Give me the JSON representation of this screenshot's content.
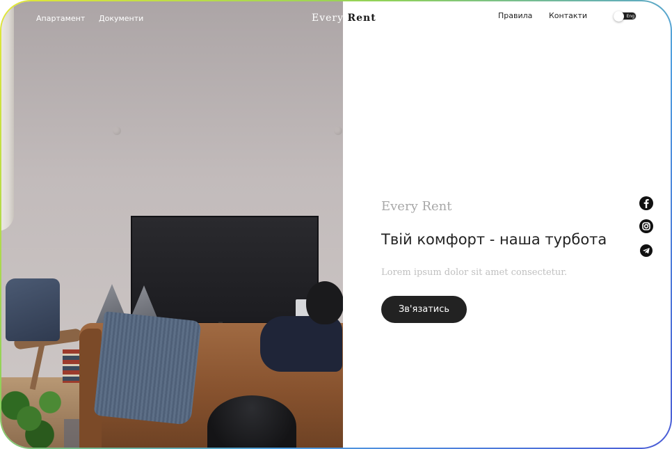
{
  "nav": {
    "left_links": [
      "Апартамент",
      "Документи"
    ],
    "logo": {
      "part_left": "Every ",
      "part_right": "Rent"
    },
    "right_links": [
      "Правила",
      "Контакти"
    ],
    "language_toggle": {
      "label": "Eng"
    }
  },
  "hero": {
    "brand": "Every Rent",
    "headline": "Твій комфорт - наша турбота",
    "lead": "Lorem ipsum dolor sit amet consectetur.",
    "cta_label": "Зв'язатись"
  },
  "social": [
    "facebook-icon",
    "instagram-icon",
    "telegram-icon"
  ],
  "colors": {
    "text_dark": "#222222",
    "button": "#222222",
    "muted": "#a8a8a8",
    "frame_gradient": [
      "#e4e836",
      "#8fd15a",
      "#4f9fe0",
      "#4a5bd6"
    ]
  }
}
